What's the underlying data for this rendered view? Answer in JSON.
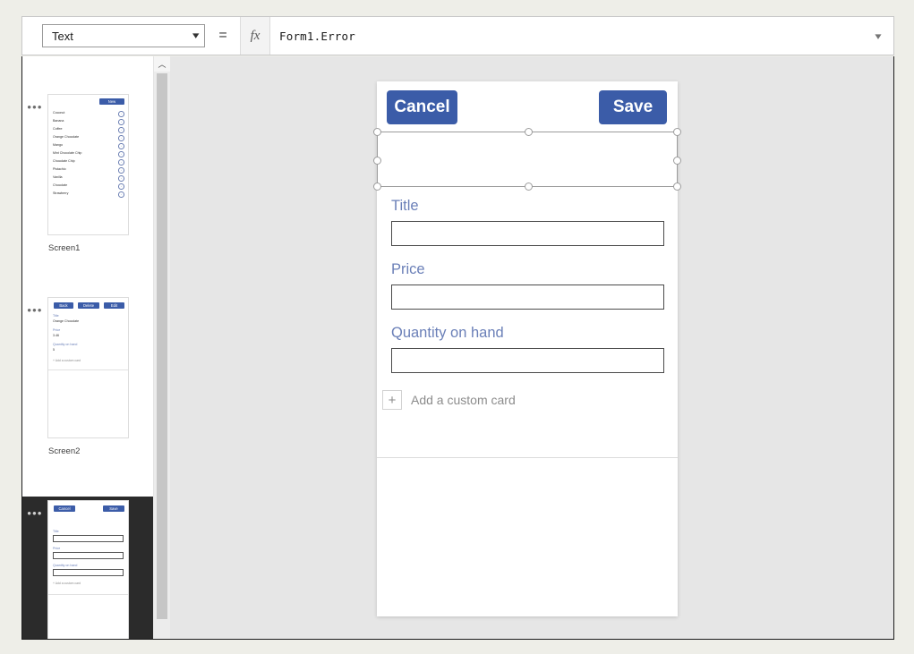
{
  "formula_bar": {
    "property": "Text",
    "property_icon": "chevron-down-icon",
    "equals": "=",
    "fx": "fx",
    "formula": "Form1.Error",
    "expand_icon": "chevron-down-icon"
  },
  "thumbnails": {
    "menu_icon": "•••",
    "scroll_up_icon": "︿",
    "items": [
      {
        "label": "Screen1",
        "selected": false,
        "type": "gallery",
        "button": "New",
        "rows": [
          "Coconut",
          "Banana",
          "Coffee",
          "Orange Chocolate",
          "Mango",
          "Mint Chocolate Chip",
          "Chocolate Chip",
          "Pistachio",
          "Vanilla",
          "Chocolate",
          "Strawberry"
        ],
        "row_arrow": "›"
      },
      {
        "label": "Screen2",
        "selected": false,
        "type": "detail",
        "buttons": [
          "Back",
          "Delete",
          "Edit"
        ],
        "fields": [
          {
            "label": "Title",
            "value": "Orange Chocolate"
          },
          {
            "label": "Price",
            "value": "3.46"
          },
          {
            "label": "Quantity on hand",
            "value": "5"
          }
        ],
        "add_card": "Add a custom card",
        "add_card_icon": "plus-icon"
      },
      {
        "label": "",
        "selected": true,
        "type": "edit",
        "buttons": [
          "Cancel",
          "Save"
        ],
        "fields": [
          {
            "label": "Title",
            "value": ""
          },
          {
            "label": "Price",
            "value": ""
          },
          {
            "label": "Quantity on hand",
            "value": ""
          }
        ],
        "add_card": "Add a custom card",
        "add_card_icon": "plus-icon"
      }
    ]
  },
  "canvas": {
    "screen": {
      "cancel_label": "Cancel",
      "save_label": "Save",
      "fields": [
        {
          "label": "Title",
          "value": "",
          "placeholder": ""
        },
        {
          "label": "Price",
          "value": "",
          "placeholder": ""
        },
        {
          "label": "Quantity on hand",
          "value": "",
          "placeholder": ""
        }
      ],
      "add_card_label": "Add a custom card",
      "add_card_icon": "plus-icon"
    },
    "selection": {
      "handle_icon": "resize-handle"
    }
  },
  "colors": {
    "accent_blue": "#3b5ca8",
    "label_blue": "#6b80b8",
    "canvas_bg": "#e6e6e6",
    "page_bg": "#eeeee8",
    "selected_thumb_bg": "#2b2b2b"
  }
}
